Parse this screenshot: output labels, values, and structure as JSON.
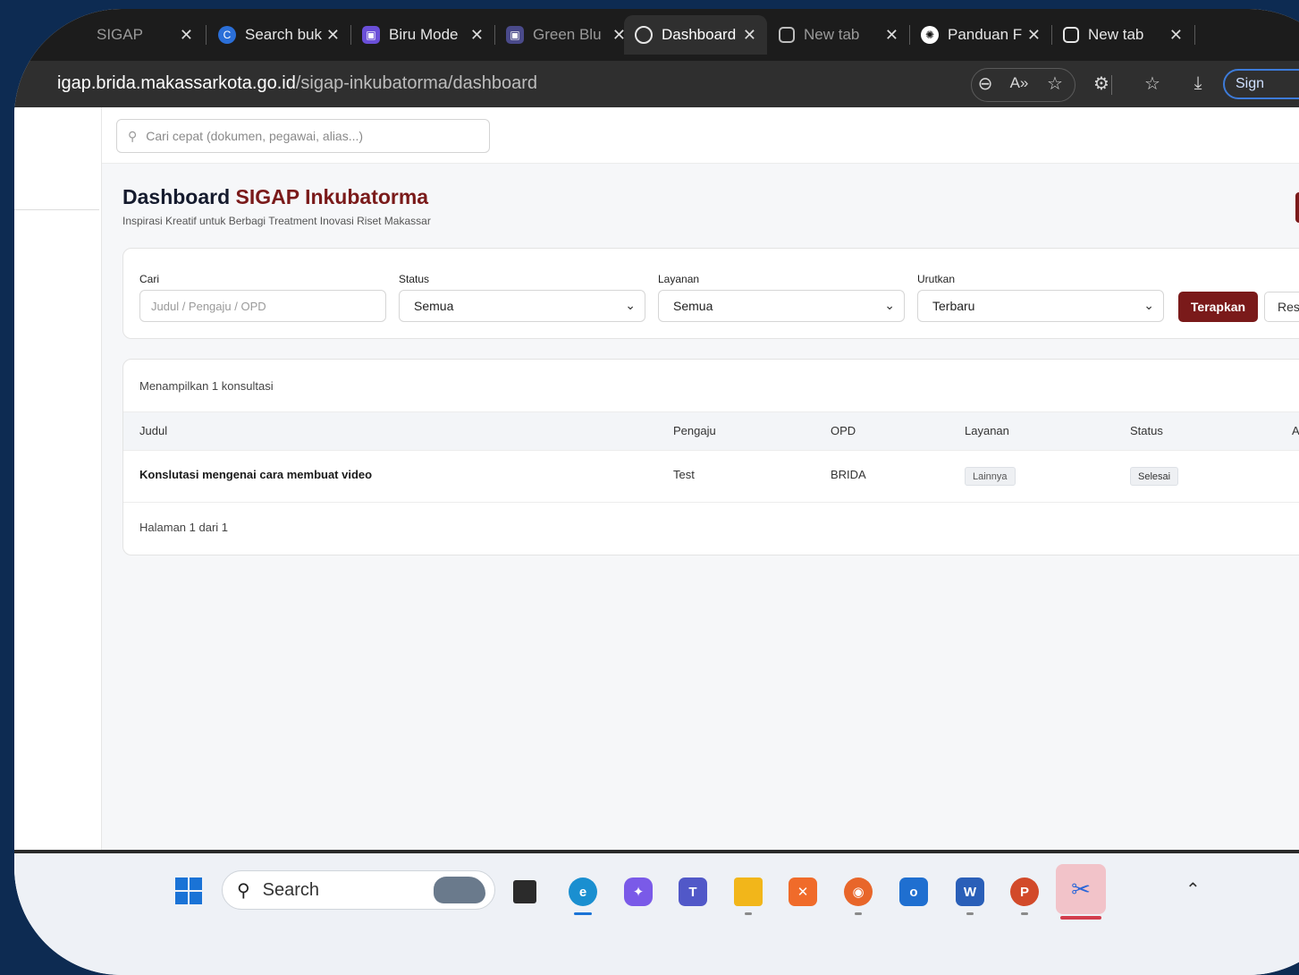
{
  "browser": {
    "tabs": [
      {
        "label": "SIGAP",
        "icon": "page-icon",
        "active": false
      },
      {
        "label": "Search buk",
        "icon": "search-app-icon",
        "active": false
      },
      {
        "label": "Biru Mode",
        "icon": "app-icon",
        "active": false
      },
      {
        "label": "Green Blu",
        "icon": "app-icon",
        "active": false
      },
      {
        "label": "Dashboard",
        "icon": "globe-icon",
        "active": true
      },
      {
        "label": "New tab",
        "icon": "newtab-icon",
        "active": false
      },
      {
        "label": "Panduan F",
        "icon": "chatgpt-icon",
        "active": false
      },
      {
        "label": "New tab",
        "icon": "newtab-icon",
        "active": false
      }
    ],
    "url_host": "igap.brida.makassarkota.go.id",
    "url_path": "/sigap-inkubatorma/dashboard",
    "sign_in_label": "Sign"
  },
  "quick_search": {
    "placeholder": "Cari cepat (dokumen, pegawai, alias...)"
  },
  "header": {
    "title_prefix": "Dashboard",
    "title_accent": "SIGAP Inkubatorma",
    "subtitle": "Inspirasi Kreatif untuk Berbagi Treatment Inovasi Riset Makassar"
  },
  "filters": {
    "search_label": "Cari",
    "search_placeholder": "Judul / Pengaju / OPD",
    "status_label": "Status",
    "status_value": "Semua",
    "service_label": "Layanan",
    "service_value": "Semua",
    "sort_label": "Urutkan",
    "sort_value": "Terbaru",
    "apply_label": "Terapkan",
    "reset_label": "Reset"
  },
  "results": {
    "count_text": "Menampilkan 1 konsultasi",
    "columns": [
      "Judul",
      "Pengaju",
      "OPD",
      "Layanan",
      "Status",
      "Aksi"
    ],
    "rows": [
      {
        "judul": "Konslutasi mengenai cara membuat video",
        "pengaju": "Test",
        "opd": "BRIDA",
        "layanan": "Lainnya",
        "status": "Selesai"
      }
    ],
    "pagination": "Halaman 1 dari 1"
  },
  "taskbar": {
    "search_label": "Search",
    "apps": [
      "start-icon",
      "task-view-icon",
      "edge-icon",
      "copilot-icon",
      "teams-icon",
      "file-explorer-icon",
      "xampp-icon",
      "firefox-icon",
      "outlook-icon",
      "word-icon",
      "powerpoint-icon",
      "snipping-tool-icon"
    ]
  },
  "colors": {
    "accent": "#7a1a1a",
    "background": "#0d2b52"
  }
}
